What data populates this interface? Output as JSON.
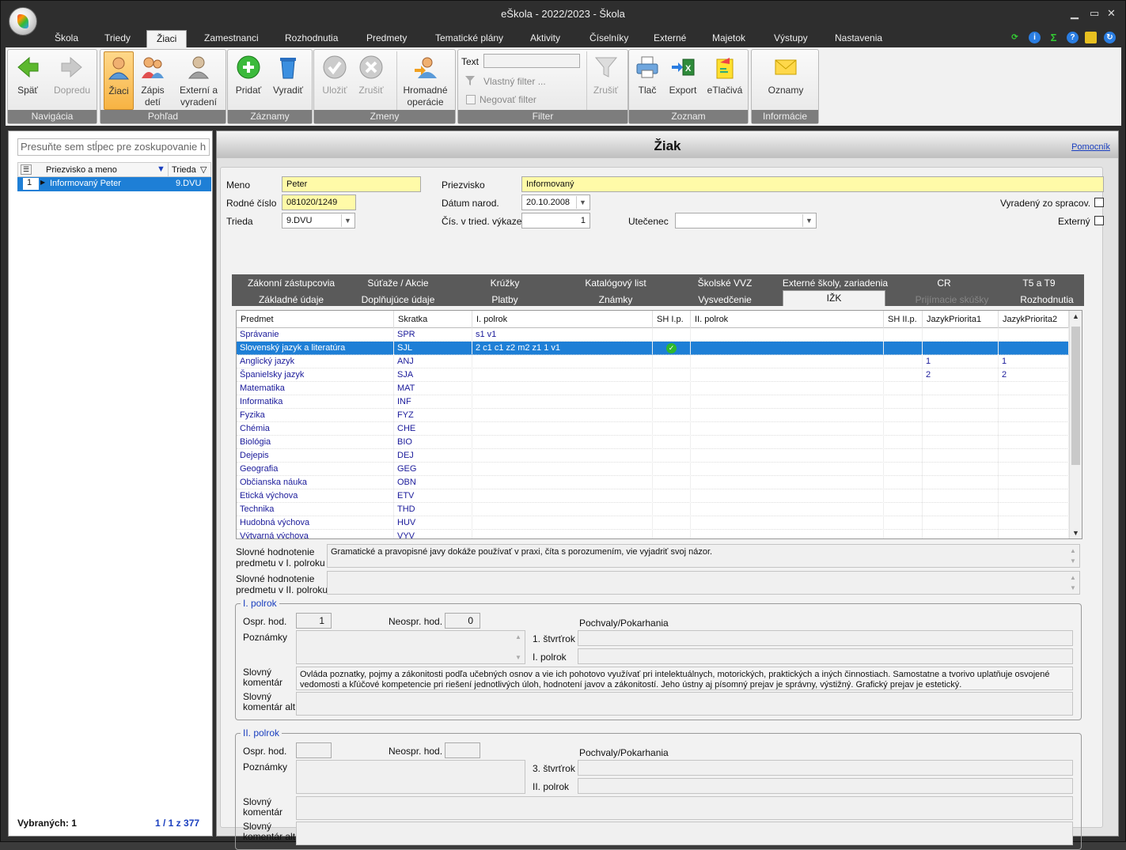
{
  "app": {
    "title": "eŠkola - 2022/2023 - Škola"
  },
  "menu": [
    "Škola",
    "Triedy",
    "Žiaci",
    "Zamestnanci",
    "Rozhodnutia",
    "Predmety",
    "Tematické plány",
    "Aktivity",
    "Číselníky",
    "Externé",
    "Majetok",
    "Výstupy",
    "Nastavenia"
  ],
  "ribbon": {
    "nav": {
      "caption": "Navigácia",
      "back": "Späť",
      "forward": "Dopredu"
    },
    "view": {
      "caption": "Pohľad",
      "students": "Žiaci",
      "enroll1": "Zápis",
      "enroll2": "detí",
      "ext1": "Externí a",
      "ext2": "vyradení"
    },
    "records": {
      "caption": "Záznamy",
      "add": "Pridať",
      "remove": "Vyradiť"
    },
    "changes": {
      "caption": "Zmeny",
      "save": "Uložiť",
      "cancel": "Zrušiť",
      "bulk1": "Hromadné",
      "bulk2": "operácie"
    },
    "filter": {
      "caption": "Filter",
      "text_label": "Text",
      "custom": "Vlastný filter ...",
      "negate": "Negovať filter",
      "cancel": "Zrušiť"
    },
    "list": {
      "caption": "Zoznam",
      "print": "Tlač",
      "export": "Export",
      "eprint": "eTlačivá"
    },
    "info": {
      "caption": "Informácie",
      "notices": "Oznamy"
    }
  },
  "left": {
    "group_hint": "Presuňte sem stĺpec pre zoskupovanie h",
    "cols": {
      "name": "Priezvisko a meno",
      "cls": "Trieda"
    },
    "rows": [
      {
        "n": "1",
        "name": "Informovaný Peter",
        "cls": "9.DVU"
      }
    ],
    "selected_label": "Vybraných: 1",
    "pager": "1 / 1 z 377"
  },
  "form": {
    "header": "Žiak",
    "help": "Pomocník",
    "labels": {
      "first": "Meno",
      "last": "Priezvisko",
      "birthno": "Rodné číslo",
      "dob": "Dátum narod.",
      "cls": "Trieda",
      "clsno": "Čís. v tried. výkaze",
      "refugee": "Utečenec",
      "excluded": "Vyradený zo spracov.",
      "external": "Externý"
    },
    "values": {
      "first": "Peter",
      "last": "Informovaný",
      "birthno": "081020/1249",
      "dob": "20.10.2008",
      "cls": "9.DVU",
      "clsno": "1",
      "refugee": ""
    }
  },
  "tabs_top": [
    "Zákonní zástupcovia",
    "Súťaže / Akcie",
    "Krúžky",
    "Katalógový list",
    "Školské VVZ",
    "Externé školy, zariadenia",
    "CR",
    "T5 a T9"
  ],
  "tabs_bottom": [
    "Základné údaje",
    "Doplňujúce údaje",
    "Platby",
    "Známky",
    "Vysvedčenie",
    "IŽK",
    "Prijímacie skúšky",
    "Rozhodnutia"
  ],
  "grid": {
    "cols": [
      "Predmet",
      "Skratka",
      "I. polrok",
      "SH I.p.",
      "II. polrok",
      "SH II.p.",
      "JazykPriorita1",
      "JazykPriorita2"
    ],
    "rows": [
      [
        "Správanie",
        "SPR",
        "s1 v1",
        "",
        "",
        "",
        "",
        ""
      ],
      [
        "Slovenský jazyk a literatúra",
        "SJL",
        "2 c1 c1 z2 m2 z1 1 v1",
        "",
        "",
        "",
        "",
        ""
      ],
      [
        "Anglický jazyk",
        "ANJ",
        "",
        "",
        "",
        "",
        "1",
        "1"
      ],
      [
        "Španielsky jazyk",
        "SJA",
        "",
        "",
        "",
        "",
        "2",
        "2"
      ],
      [
        "Matematika",
        "MAT",
        "",
        "",
        "",
        "",
        "",
        ""
      ],
      [
        "Informatika",
        "INF",
        "",
        "",
        "",
        "",
        "",
        ""
      ],
      [
        "Fyzika",
        "FYZ",
        "",
        "",
        "",
        "",
        "",
        ""
      ],
      [
        "Chémia",
        "CHE",
        "",
        "",
        "",
        "",
        "",
        ""
      ],
      [
        "Biológia",
        "BIO",
        "",
        "",
        "",
        "",
        "",
        ""
      ],
      [
        "Dejepis",
        "DEJ",
        "",
        "",
        "",
        "",
        "",
        ""
      ],
      [
        "Geografia",
        "GEG",
        "",
        "",
        "",
        "",
        "",
        ""
      ],
      [
        "Občianska náuka",
        "OBN",
        "",
        "",
        "",
        "",
        "",
        ""
      ],
      [
        "Etická výchova",
        "ETV",
        "",
        "",
        "",
        "",
        "",
        ""
      ],
      [
        "Technika",
        "THD",
        "",
        "",
        "",
        "",
        "",
        ""
      ],
      [
        "Hudobná výchova",
        "HUV",
        "",
        "",
        "",
        "",
        "",
        ""
      ],
      [
        "Výtvarná výchova",
        "VYV",
        "",
        "",
        "",
        "",
        "",
        ""
      ]
    ]
  },
  "verbal": {
    "l1a": "Slovné hodnotenie",
    "l1b": "predmetu v I. polroku",
    "v1": "Gramatické a pravopisné javy dokáže používať v praxi, číta s porozumením, vie vyjadriť svoj názor.",
    "l2a": "Slovné hodnotenie",
    "l2b": "predmetu v II. polroku",
    "v2": ""
  },
  "h1": {
    "legend": "I. polrok",
    "excused": "Ospr. hod.",
    "excused_v": "1",
    "unexcused": "Neospr. hod.",
    "unexcused_v": "0",
    "notes": "Poznámky",
    "praise": "Pochvaly/Pokarhania",
    "q1": "1. štvrťrok",
    "q2": "I. polrok",
    "comment_a": "Slovný",
    "comment_b": "komentár",
    "comment": "Ovláda poznatky, pojmy a zákonitosti podľa učebných osnov a vie ich pohotovo využívať pri intelektuálnych, motorických, praktických a iných činnostiach. Samostatne a tvorivo uplatňuje osvojené vedomosti a kľúčové kompetencie pri riešení jednotlivých úloh, hodnotení javov a zákonitostí. Jeho ústny aj písomný prejav je správny, výstižný. Grafický prejav je estetický.",
    "alt_a": "Slovný",
    "alt_b": "komentár alt."
  },
  "h2": {
    "legend": "II. polrok",
    "excused": "Ospr. hod.",
    "unexcused": "Neospr. hod.",
    "notes": "Poznámky",
    "praise": "Pochvaly/Pokarhania",
    "q3": "3. štvrťrok",
    "q4": "II. polrok",
    "comment_a": "Slovný",
    "comment_b": "komentár",
    "alt_a": "Slovný",
    "alt_b": "komentár alt."
  },
  "colors": {
    "accent": "#1e7fd6",
    "yellow_field": "#fffaa8",
    "ribbon_caption": "#7d7d7d",
    "selected_button": "#f7b343"
  }
}
